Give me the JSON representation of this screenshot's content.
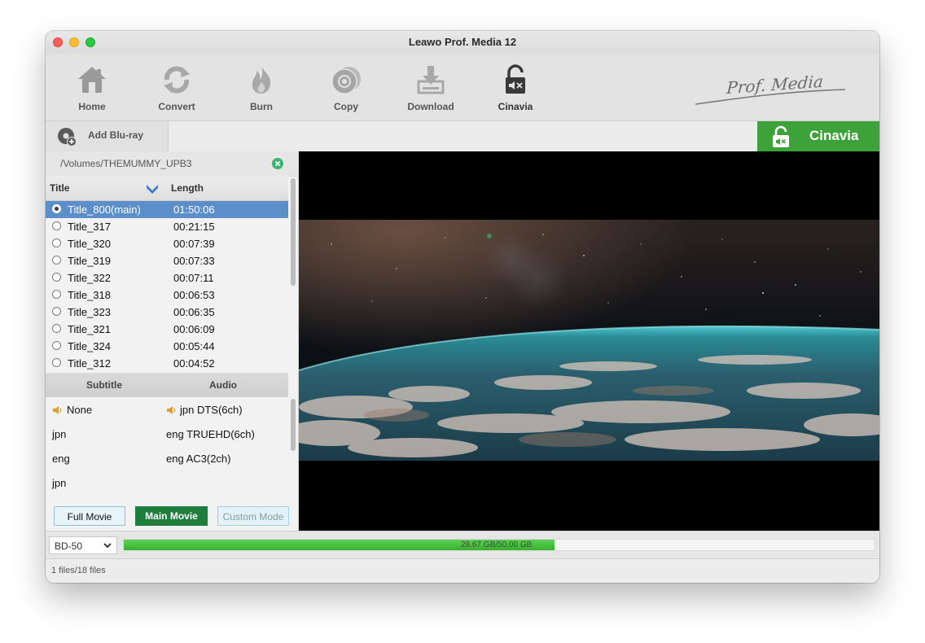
{
  "window": {
    "title": "Leawo Prof. Media 12"
  },
  "toolbar": {
    "items": [
      {
        "label": "Home",
        "icon": "home-icon"
      },
      {
        "label": "Convert",
        "icon": "convert-icon"
      },
      {
        "label": "Burn",
        "icon": "burn-icon"
      },
      {
        "label": "Copy",
        "icon": "copy-icon"
      },
      {
        "label": "Download",
        "icon": "download-icon"
      },
      {
        "label": "Cinavia",
        "icon": "cinavia-icon"
      }
    ],
    "brand": "Prof. Media"
  },
  "tabs": {
    "add_bluray": "Add Blu-ray",
    "cinavia": "Cinavia"
  },
  "source": {
    "path": "/Volumes/THEMUMMY_UPB3"
  },
  "titles": {
    "header_title": "Title",
    "header_length": "Length",
    "rows": [
      {
        "name": "Title_800(main)",
        "length": "01:50:06",
        "selected": true
      },
      {
        "name": "Title_317",
        "length": "00:21:15"
      },
      {
        "name": "Title_320",
        "length": "00:07:39"
      },
      {
        "name": "Title_319",
        "length": "00:07:33"
      },
      {
        "name": "Title_322",
        "length": "00:07:11"
      },
      {
        "name": "Title_318",
        "length": "00:06:53"
      },
      {
        "name": "Title_323",
        "length": "00:06:35"
      },
      {
        "name": "Title_321",
        "length": "00:06:09"
      },
      {
        "name": "Title_324",
        "length": "00:05:44"
      },
      {
        "name": "Title_312",
        "length": "00:04:52"
      }
    ]
  },
  "tracks": {
    "subtitle_header": "Subtitle",
    "audio_header": "Audio",
    "subtitles": [
      "None",
      "jpn",
      "eng",
      "jpn"
    ],
    "audio": [
      "jpn DTS(6ch)",
      "eng TRUEHD(6ch)",
      "eng AC3(2ch)"
    ]
  },
  "modes": {
    "full": "Full Movie",
    "main": "Main Movie",
    "custom": "Custom Mode"
  },
  "bottom": {
    "disc_type": "BD-50",
    "progress_text": "28.67 GB/50.00 GB",
    "used_gb": 28.67,
    "total_gb": 50.0
  },
  "status": {
    "files": "1 files/18 files"
  },
  "colors": {
    "accent_green": "#3ea23a",
    "selection": "#5c8ec9",
    "main_mode": "#1f7e3d"
  }
}
